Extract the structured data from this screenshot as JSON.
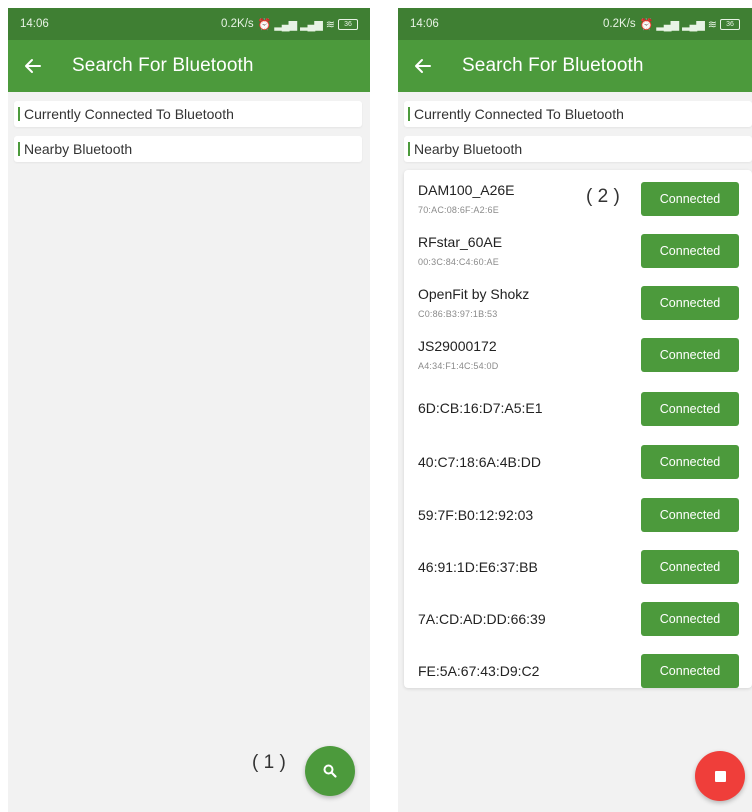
{
  "status_bar": {
    "time": "14:06",
    "network_speed": "0.2K/s",
    "battery_level": "36"
  },
  "app_bar": {
    "title": "Search For Bluetooth"
  },
  "sections": {
    "connected_label": "Currently Connected To Bluetooth",
    "nearby_label": "Nearby Bluetooth"
  },
  "annotations": {
    "left": "( 1 )",
    "right": "( 2 )"
  },
  "devices": [
    {
      "name": "DAM100_A26E",
      "mac": "70:AC:08:6F:A2:6E",
      "button": "Connected"
    },
    {
      "name": "RFstar_60AE",
      "mac": "00:3C:84:C4:60:AE",
      "button": "Connected"
    },
    {
      "name": "OpenFit by Shokz",
      "mac": "C0:86:B3:97:1B:53",
      "button": "Connected"
    },
    {
      "name": "JS29000172",
      "mac": "A4:34:F1:4C:54:0D",
      "button": "Connected"
    },
    {
      "name": "6D:CB:16:D7:A5:E1",
      "mac": "",
      "button": "Connected"
    },
    {
      "name": "40:C7:18:6A:4B:DD",
      "mac": "",
      "button": "Connected"
    },
    {
      "name": "59:7F:B0:12:92:03",
      "mac": "",
      "button": "Connected"
    },
    {
      "name": "46:91:1D:E6:37:BB",
      "mac": "",
      "button": "Connected"
    },
    {
      "name": "7A:CD:AD:DD:66:39",
      "mac": "",
      "button": "Connected"
    },
    {
      "name": "FE:5A:67:43:D9:C2",
      "mac": "",
      "button": "Connected"
    }
  ],
  "colors": {
    "status_bar": "#3f7f33",
    "app_bar": "#4c9a3c",
    "accent": "#4c9a3c",
    "stop_fab": "#ef3e3a"
  },
  "icons": {
    "back": "arrow-left-icon",
    "search": "search-icon",
    "stop": "stop-icon"
  }
}
